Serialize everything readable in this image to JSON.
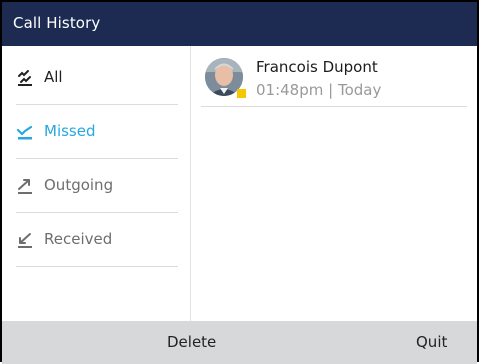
{
  "header": {
    "title": "Call History"
  },
  "sidebar": {
    "items": [
      {
        "label": "All",
        "icon": "all-calls-icon"
      },
      {
        "label": "Missed",
        "icon": "missed-call-icon"
      },
      {
        "label": "Outgoing",
        "icon": "outgoing-call-icon"
      },
      {
        "label": "Received",
        "icon": "received-call-icon"
      }
    ],
    "selected": "Missed"
  },
  "calls": [
    {
      "name": "Francois Dupont",
      "time": "01:48pm | Today",
      "presence": "away"
    }
  ],
  "softkeys": {
    "left": "Delete",
    "right": "Quit"
  },
  "colors": {
    "header_bg": "#1d2b52",
    "accent": "#26a8e0",
    "softkey_bg": "#d7d8d9",
    "presence": "#f6c700"
  }
}
